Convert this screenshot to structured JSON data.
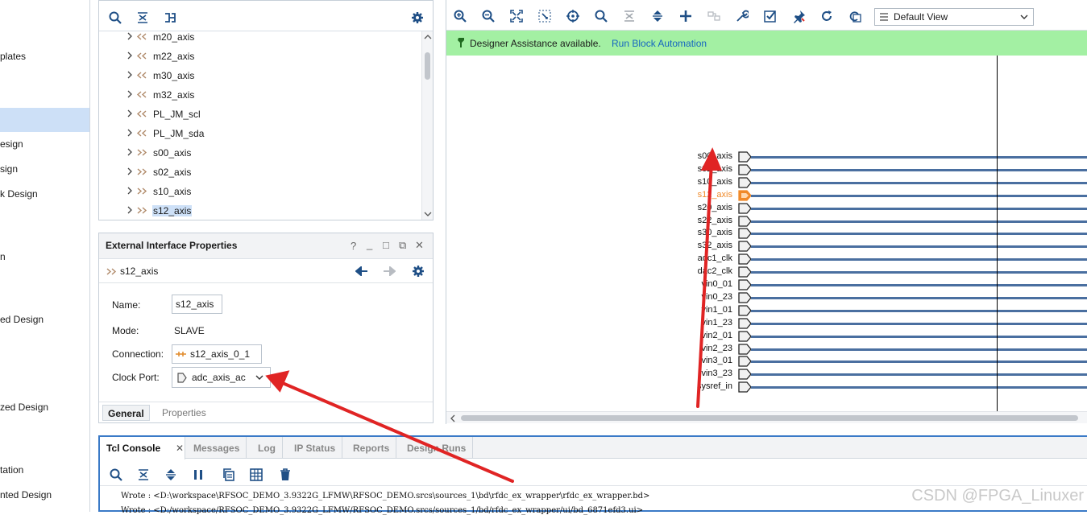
{
  "flow_navigator": {
    "items": [
      "plates",
      "esign",
      "sign",
      "k Design",
      "n",
      "ed Design",
      "zed Design",
      "tation",
      "nted Design"
    ]
  },
  "sources": {
    "tree": [
      {
        "label": "m20_axis",
        "kind": "master"
      },
      {
        "label": "m22_axis",
        "kind": "master"
      },
      {
        "label": "m30_axis",
        "kind": "master"
      },
      {
        "label": "m32_axis",
        "kind": "master"
      },
      {
        "label": "PL_JM_scl",
        "kind": "master"
      },
      {
        "label": "PL_JM_sda",
        "kind": "master"
      },
      {
        "label": "s00_axis",
        "kind": "slave"
      },
      {
        "label": "s02_axis",
        "kind": "slave"
      },
      {
        "label": "s10_axis",
        "kind": "slave"
      },
      {
        "label": "s12_axis",
        "kind": "slave",
        "selected": true
      }
    ]
  },
  "properties": {
    "title": "External Interface Properties",
    "header_controls": [
      "?",
      "_",
      "□",
      "⧉",
      "✕"
    ],
    "object_name": "s12_axis",
    "fields": {
      "name_label": "Name:",
      "name_value": "s12_axis",
      "mode_label": "Mode:",
      "mode_value": "SLAVE",
      "connection_label": "Connection:",
      "connection_value": "s12_axis_0_1",
      "clock_label": "Clock Port:",
      "clock_value": "adc_axis_ac"
    },
    "tabs": [
      "General",
      "Properties"
    ],
    "active_tab": "General"
  },
  "diagram": {
    "view_select": "Default View",
    "assist_message": "Designer Assistance available.",
    "assist_link": "Run Block Automation",
    "ports": [
      "s00_axis",
      "s02_axis",
      "s10_axis",
      "s12_axis",
      "s20_axis",
      "s22_axis",
      "s30_axis",
      "s32_axis",
      "adc1_clk",
      "dac2_clk",
      "vin0_01",
      "vin0_23",
      "vin1_01",
      "vin1_23",
      "vin2_01",
      "vin2_23",
      "vin3_01",
      "vin3_23",
      "sysref_in"
    ],
    "highlighted_port": "s12_axis",
    "colors": {
      "wire": "#4a6fa0",
      "highlight": "#f08a2a",
      "assist_bg": "#a3f0a3",
      "link": "#1565c0"
    }
  },
  "console": {
    "tabs": [
      "Tcl Console",
      "Messages",
      "Log",
      "IP Status",
      "Reports",
      "Design Runs"
    ],
    "active_tab": "Tcl Console",
    "lines": [
      "Wrote  : <D:\\workspace\\RFSOC_DEMO_3.9322G_LFMW\\RFSOC_DEMO.srcs\\sources_1\\bd\\rfdc_ex_wrapper\\rfdc_ex_wrapper.bd>",
      "Wrote  : <D:/workspace/RFSOC_DEMO_3.9322G_LFMW/RFSOC_DEMO.srcs/sources_1/bd/rfdc_ex_wrapper/ui/bd_6871efd3.ui>"
    ]
  },
  "watermark": "CSDN @FPGA_Linuxer"
}
